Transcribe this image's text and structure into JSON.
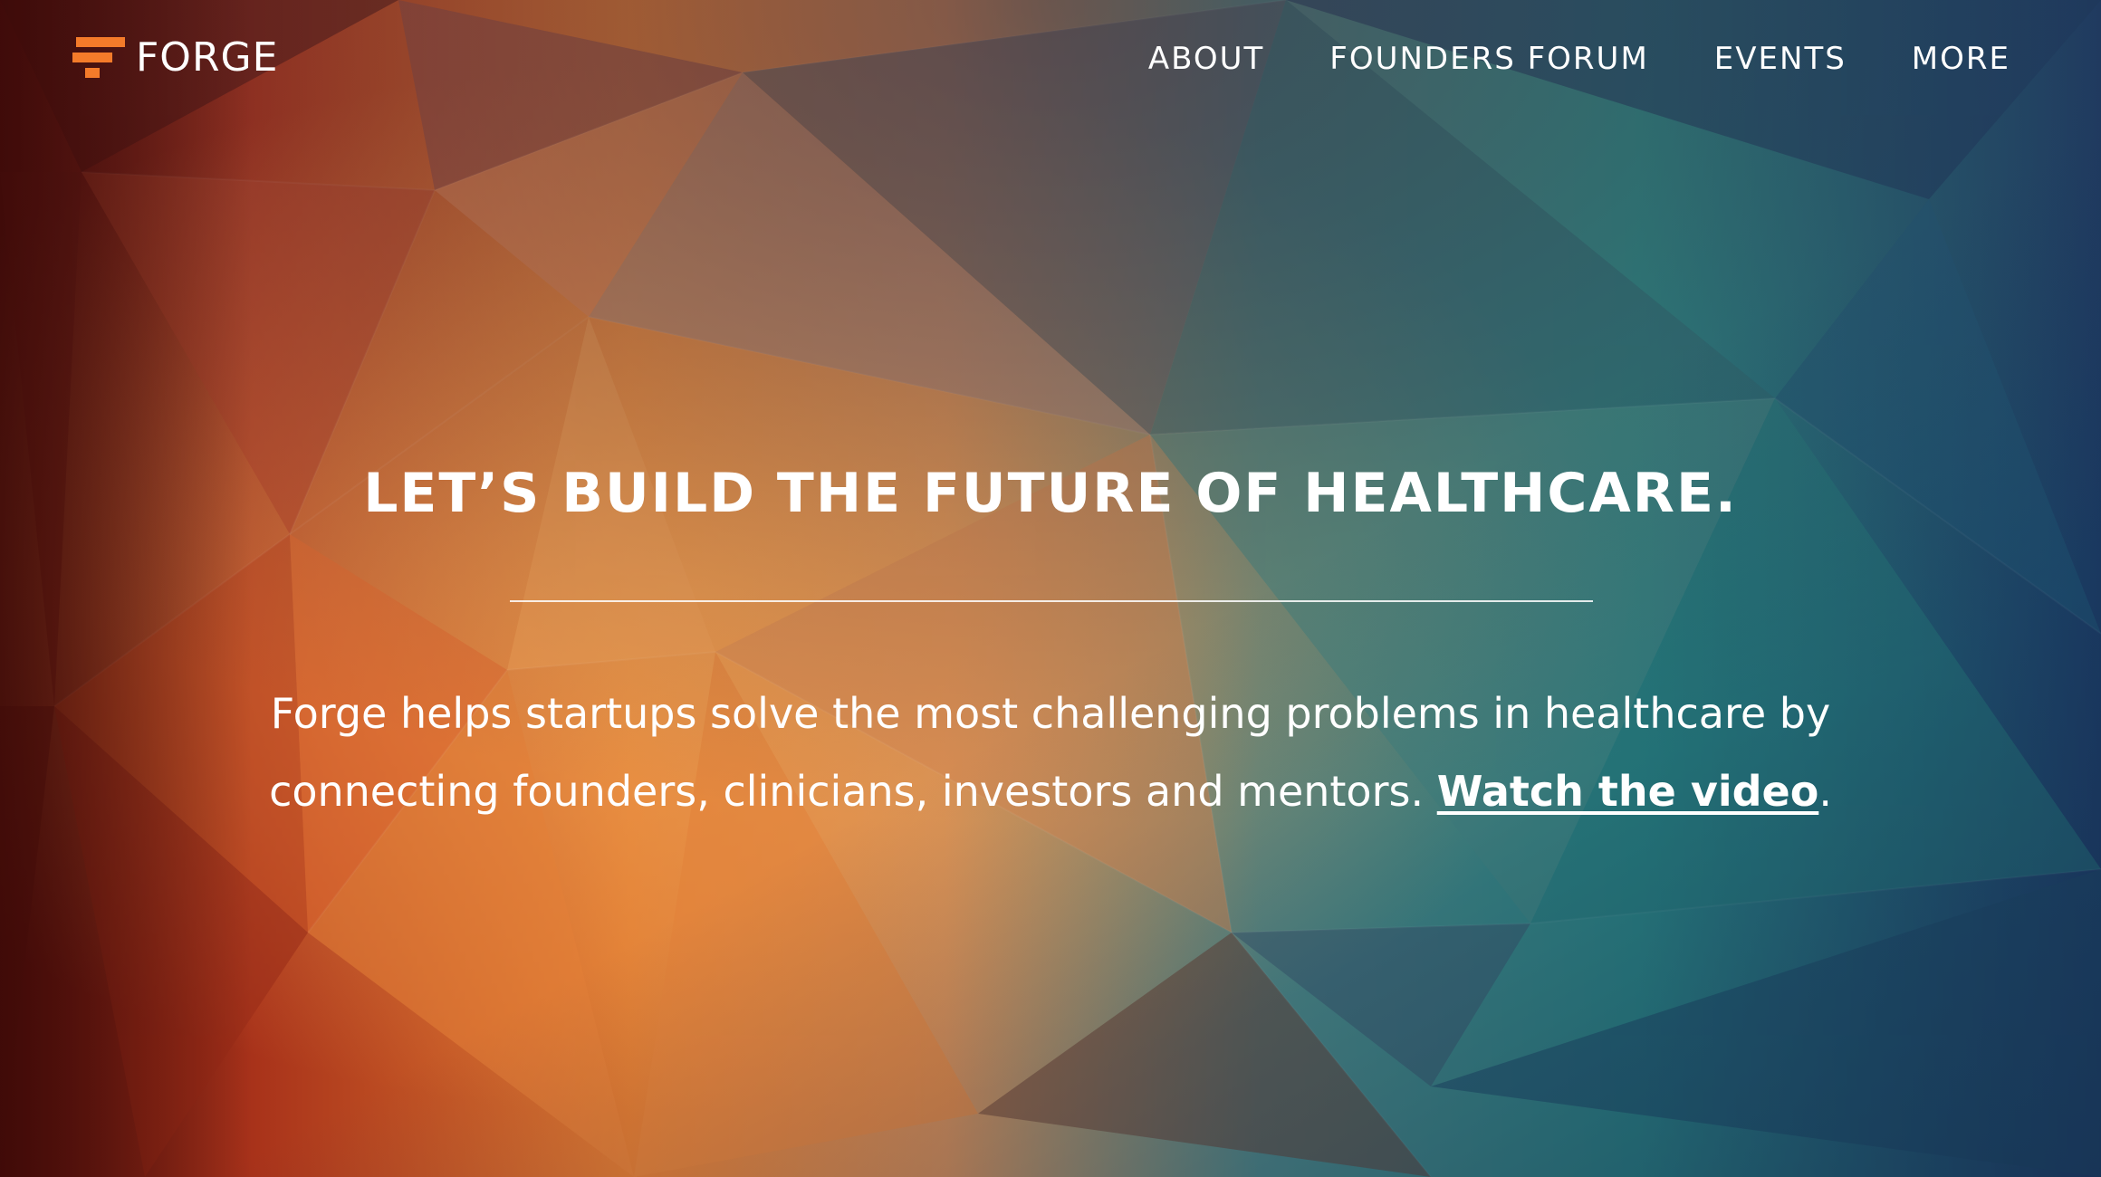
{
  "brand": {
    "name": "FORGE",
    "accent_color": "#f47b2a"
  },
  "nav": {
    "items": [
      {
        "label": "ABOUT"
      },
      {
        "label": "FOUNDERS FORUM"
      },
      {
        "label": "EVENTS"
      },
      {
        "label": "MORE"
      }
    ]
  },
  "hero": {
    "headline": "LET’S BUILD THE FUTURE OF HEALTHCARE.",
    "tagline_text": "Forge helps startups solve the most challenging problems in healthcare by connecting founders, clinicians, investors and mentors.",
    "video_link": "Watch the video",
    "tagline_end": "."
  },
  "background": {
    "palette": [
      "#5a1410",
      "#c2401c",
      "#e9893a",
      "#d8a47e",
      "#2f8c86",
      "#1e4f72",
      "#1b2f54"
    ]
  }
}
